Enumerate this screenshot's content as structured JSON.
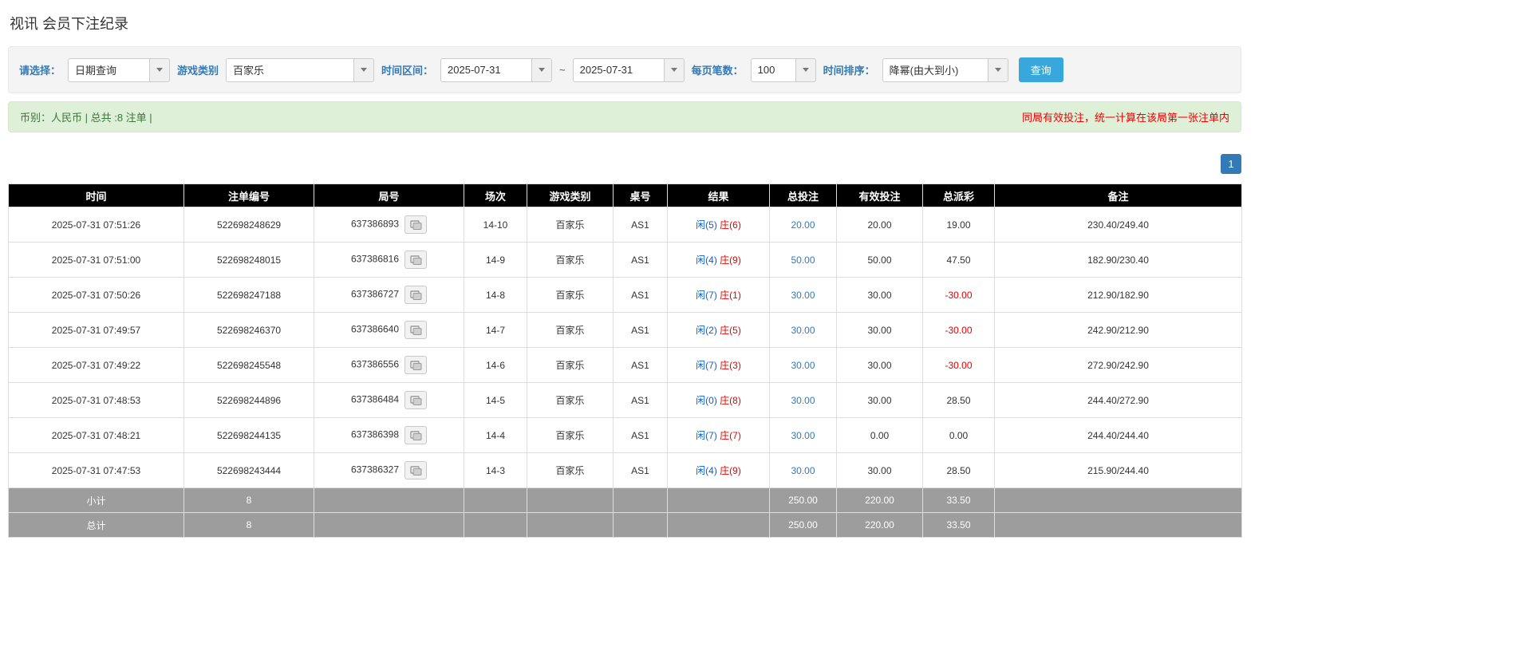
{
  "page": {
    "title": "视讯 会员下注纪录"
  },
  "colors": {
    "accent_blue": "#38a8dc",
    "pager_blue": "#337ab7",
    "link_blue": "#337ab7",
    "label_blue": "#337ab7",
    "player_blue": "#0c5fce",
    "banker_red": "#e60000",
    "negative_red": "#e60000",
    "success_bg": "#dff0d8",
    "success_border": "#d6e9c6",
    "success_text": "#3c763d",
    "warn_text": "#f00000",
    "header_bg": "#000000",
    "footer_bg": "#9d9d9d"
  },
  "filters": {
    "select_label": "请选择：",
    "select_value": "日期查询",
    "game_type_label": "游戏类别",
    "game_type_value": "百家乐",
    "date_range_label": "时间区间：",
    "date_from": "2025-07-31",
    "date_separator": "~",
    "date_to": "2025-07-31",
    "page_size_label": "每页笔数：",
    "page_size_value": "100",
    "sort_label": "时间排序：",
    "sort_value": "降幂(由大到小)",
    "search_button": "查询"
  },
  "summary": {
    "left": "币别：人民币 | 总共 :8 注单 |",
    "right": "同局有效投注，统一计算在该局第一张注单内"
  },
  "pagination": {
    "current": "1"
  },
  "table": {
    "headers": [
      "时间",
      "注单编号",
      "局号",
      "场次",
      "游戏类别",
      "桌号",
      "结果",
      "总投注",
      "有效投注",
      "总派彩",
      "备注"
    ],
    "rows": [
      {
        "time": "2025-07-31 07:51:26",
        "bet_id": "522698248629",
        "round": "637386893",
        "session": "14-10",
        "game": "百家乐",
        "table_no": "AS1",
        "result_player": "闲(5)",
        "result_banker": "庄(6)",
        "total_bet": "20.00",
        "valid_bet": "20.00",
        "payout": "19.00",
        "note": "230.40/249.40"
      },
      {
        "time": "2025-07-31 07:51:00",
        "bet_id": "522698248015",
        "round": "637386816",
        "session": "14-9",
        "game": "百家乐",
        "table_no": "AS1",
        "result_player": "闲(4)",
        "result_banker": "庄(9)",
        "total_bet": "50.00",
        "valid_bet": "50.00",
        "payout": "47.50",
        "note": "182.90/230.40"
      },
      {
        "time": "2025-07-31 07:50:26",
        "bet_id": "522698247188",
        "round": "637386727",
        "session": "14-8",
        "game": "百家乐",
        "table_no": "AS1",
        "result_player": "闲(7)",
        "result_banker": "庄(1)",
        "total_bet": "30.00",
        "valid_bet": "30.00",
        "payout": "-30.00",
        "note": "212.90/182.90"
      },
      {
        "time": "2025-07-31 07:49:57",
        "bet_id": "522698246370",
        "round": "637386640",
        "session": "14-7",
        "game": "百家乐",
        "table_no": "AS1",
        "result_player": "闲(2)",
        "result_banker": "庄(5)",
        "total_bet": "30.00",
        "valid_bet": "30.00",
        "payout": "-30.00",
        "note": "242.90/212.90"
      },
      {
        "time": "2025-07-31 07:49:22",
        "bet_id": "522698245548",
        "round": "637386556",
        "session": "14-6",
        "game": "百家乐",
        "table_no": "AS1",
        "result_player": "闲(7)",
        "result_banker": "庄(3)",
        "total_bet": "30.00",
        "valid_bet": "30.00",
        "payout": "-30.00",
        "note": "272.90/242.90"
      },
      {
        "time": "2025-07-31 07:48:53",
        "bet_id": "522698244896",
        "round": "637386484",
        "session": "14-5",
        "game": "百家乐",
        "table_no": "AS1",
        "result_player": "闲(0)",
        "result_banker": "庄(8)",
        "total_bet": "30.00",
        "valid_bet": "30.00",
        "payout": "28.50",
        "note": "244.40/272.90"
      },
      {
        "time": "2025-07-31 07:48:21",
        "bet_id": "522698244135",
        "round": "637386398",
        "session": "14-4",
        "game": "百家乐",
        "table_no": "AS1",
        "result_player": "闲(7)",
        "result_banker": "庄(7)",
        "total_bet": "30.00",
        "valid_bet": "0.00",
        "payout": "0.00",
        "note": "244.40/244.40"
      },
      {
        "time": "2025-07-31 07:47:53",
        "bet_id": "522698243444",
        "round": "637386327",
        "session": "14-3",
        "game": "百家乐",
        "table_no": "AS1",
        "result_player": "闲(4)",
        "result_banker": "庄(9)",
        "total_bet": "30.00",
        "valid_bet": "30.00",
        "payout": "28.50",
        "note": "215.90/244.40"
      }
    ],
    "subtotal": {
      "label": "小计",
      "count": "8",
      "total_bet": "250.00",
      "valid_bet": "220.00",
      "payout": "33.50"
    },
    "total": {
      "label": "总计",
      "count": "8",
      "total_bet": "250.00",
      "valid_bet": "220.00",
      "payout": "33.50"
    }
  }
}
